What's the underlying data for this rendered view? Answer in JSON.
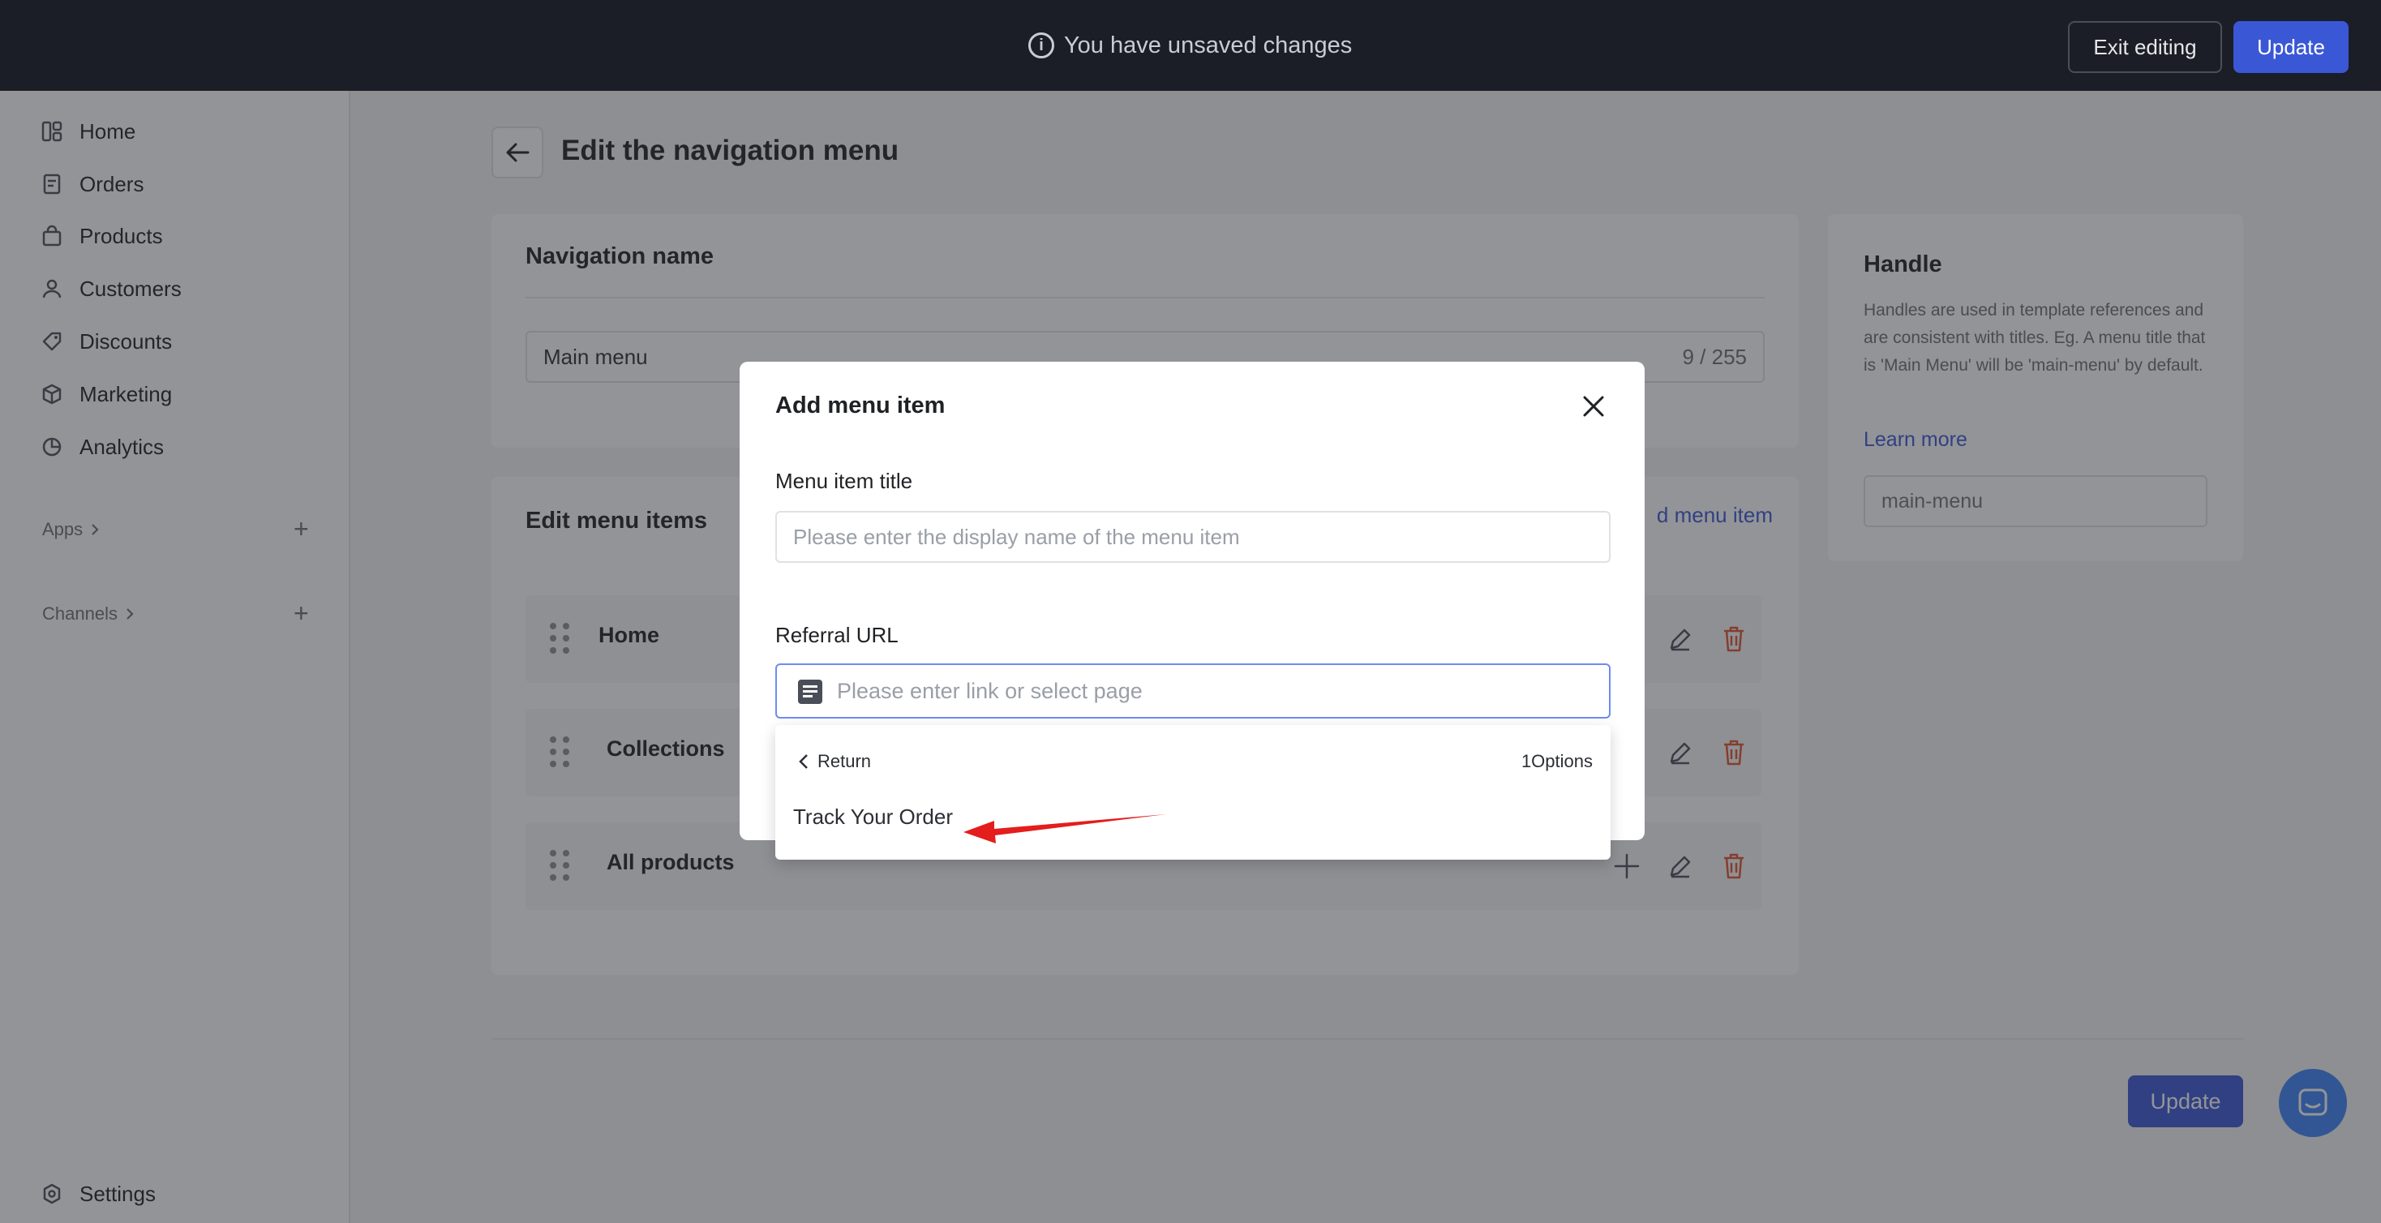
{
  "topbar": {
    "message": "You have unsaved changes",
    "exit_label": "Exit editing",
    "update_label": "Update"
  },
  "sidebar": {
    "items": [
      {
        "label": "Home",
        "icon": "dashboard-icon"
      },
      {
        "label": "Orders",
        "icon": "receipt-icon"
      },
      {
        "label": "Products",
        "icon": "bag-icon"
      },
      {
        "label": "Customers",
        "icon": "person-icon"
      },
      {
        "label": "Discounts",
        "icon": "tag-icon"
      },
      {
        "label": "Marketing",
        "icon": "cube-icon"
      },
      {
        "label": "Analytics",
        "icon": "pie-chart-icon"
      }
    ],
    "apps_label": "Apps",
    "channels_label": "Channels",
    "settings_label": "Settings"
  },
  "page": {
    "title": "Edit the navigation menu"
  },
  "nav_card": {
    "title": "Navigation name",
    "value": "Main menu",
    "counter": "9 / 255"
  },
  "menu_items_card": {
    "title": "Edit menu items",
    "add_link": "Add menu item",
    "add_link_visible": "d menu item",
    "rows": [
      {
        "label": "Home"
      },
      {
        "label": "Collections"
      },
      {
        "label": "All products"
      }
    ]
  },
  "handle_card": {
    "title": "Handle",
    "description": "Handles are used in template references and are consistent with titles. Eg. A menu title that is 'Main Menu' will be 'main-menu' by default.",
    "learn_more": "Learn more",
    "placeholder": "main-menu"
  },
  "footer": {
    "update_label": "Update"
  },
  "modal": {
    "title": "Add menu item",
    "title_label": "Menu item title",
    "title_placeholder": "Please enter the display name of the menu item",
    "url_label": "Referral URL",
    "url_placeholder": "Please enter link or select page"
  },
  "dropdown": {
    "return_label": "Return",
    "count_label": "1Options",
    "options": [
      "Track Your Order"
    ]
  },
  "colors": {
    "topbar_bg": "#1b1e26",
    "primary": "#3a57d6",
    "danger": "#e0532f",
    "annotation_arrow": "#e41d1d"
  }
}
